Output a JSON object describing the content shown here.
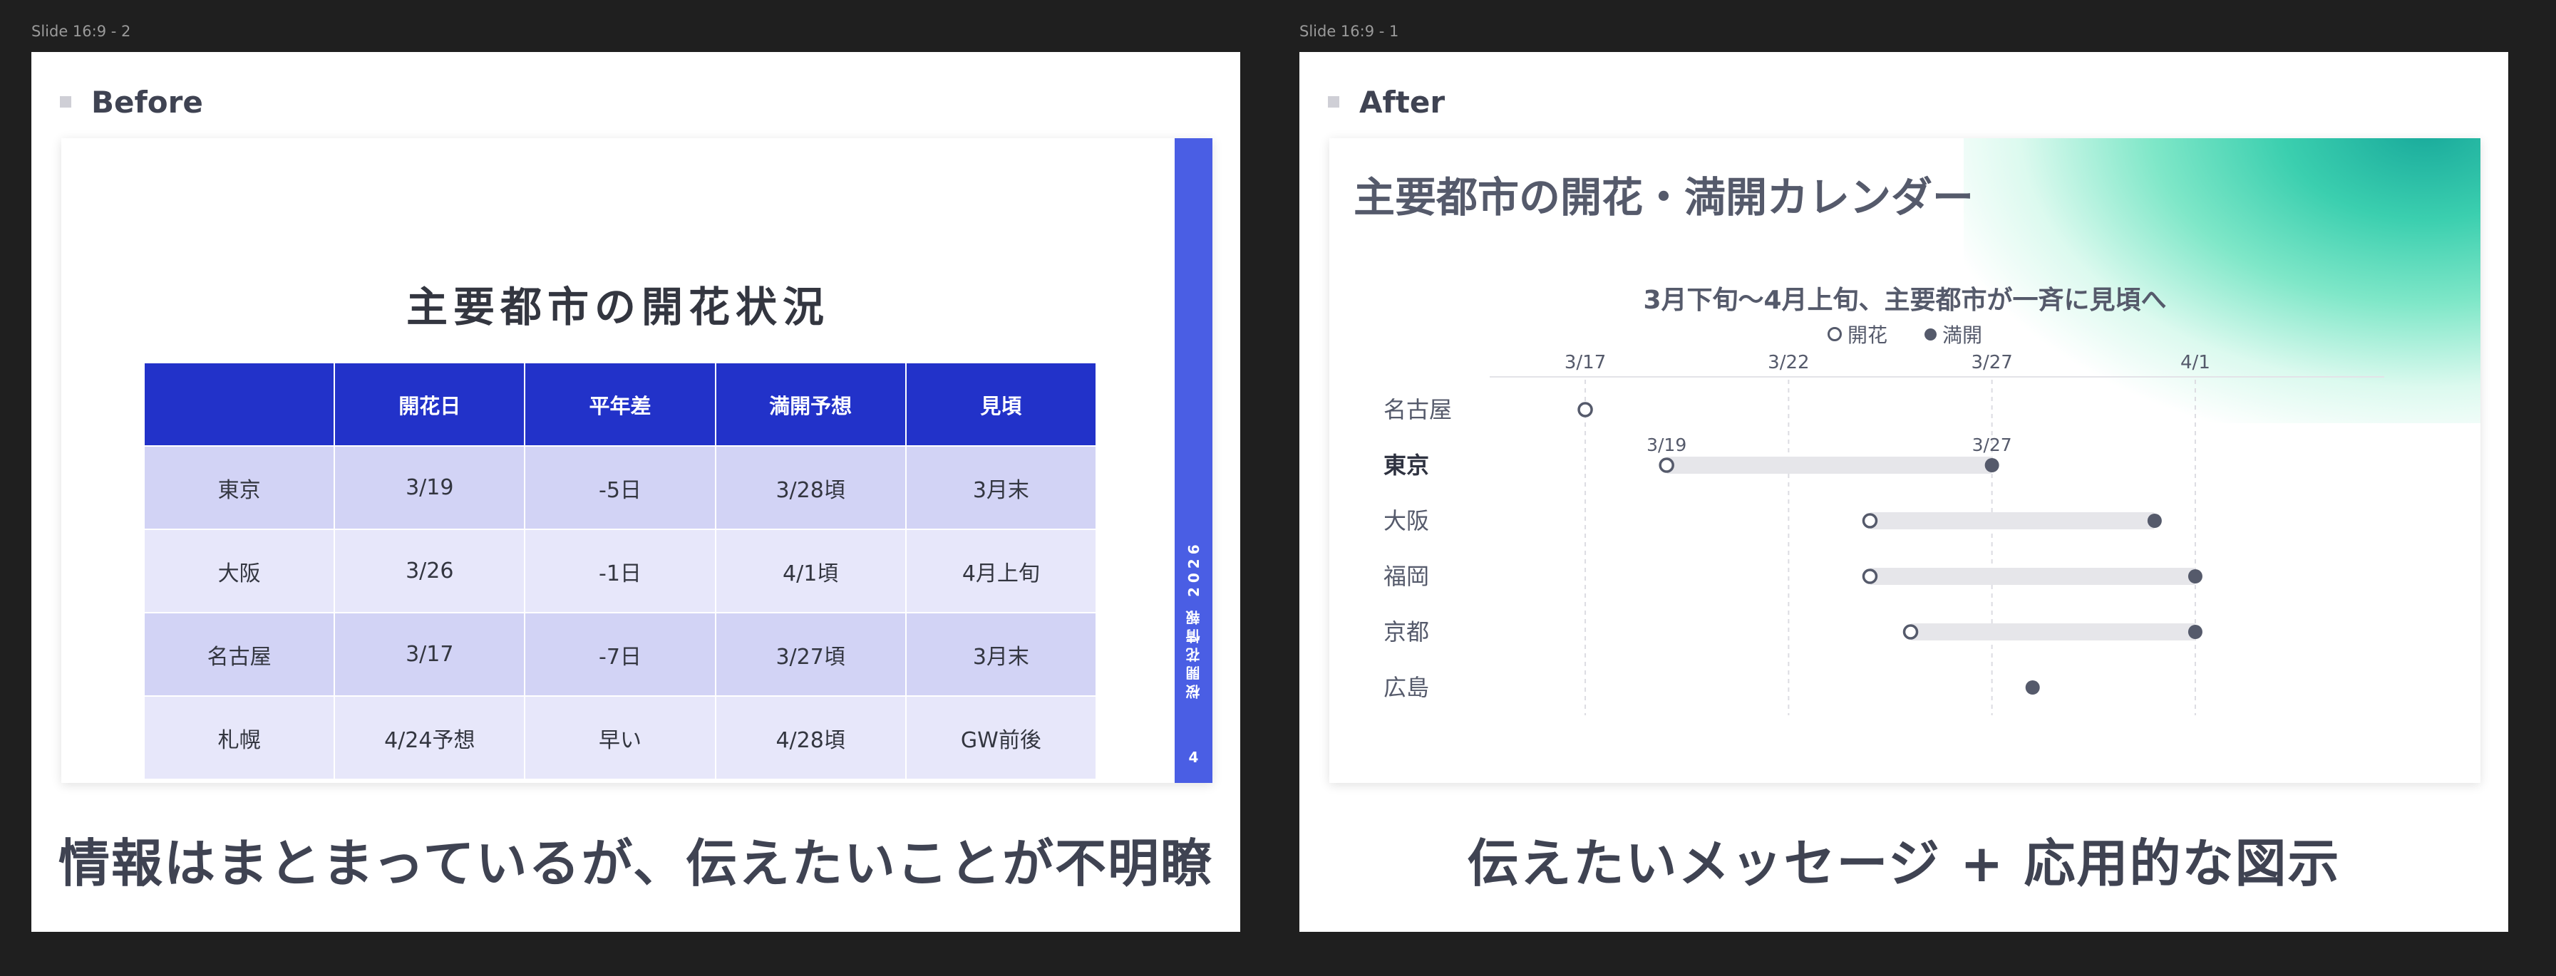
{
  "before": {
    "frame_label": "Slide 16:9 - 2",
    "section_title": "Before",
    "slide_title": "主要都市の開花状況",
    "table": {
      "headers": [
        "",
        "開花日",
        "平年差",
        "満開予想",
        "見頃"
      ],
      "rows": [
        [
          "東京",
          "3/19",
          "-5日",
          "3/28頃",
          "3月末"
        ],
        [
          "大阪",
          "3/26",
          "-1日",
          "4/1頃",
          "4月上旬"
        ],
        [
          "名古屋",
          "3/17",
          "-7日",
          "3/27頃",
          "3月末"
        ],
        [
          "札幌",
          "4/24予想",
          "早い",
          "4/28頃",
          "GW前後"
        ]
      ]
    },
    "side_band_text": "桜開花情報 2026",
    "page_number": "4",
    "caption": "情報はまとまっているが、伝えたいことが不明瞭"
  },
  "after": {
    "frame_label": "Slide 16:9 - 1",
    "section_title": "After",
    "slide_title": "主要都市の開花・満開カレンダー",
    "chart_data": {
      "type": "timeline",
      "title": "3月下旬〜4月上旬、主要都市が一斉に見頃へ",
      "legend": [
        {
          "name": "開花",
          "marker": "open-circle"
        },
        {
          "name": "満開",
          "marker": "filled-circle"
        }
      ],
      "x_axis": {
        "type": "date",
        "range": [
          "3/16",
          "4/2"
        ],
        "ticks": [
          "3/17",
          "3/22",
          "3/27",
          "4/1"
        ]
      },
      "rows": [
        {
          "city": "名古屋",
          "bloom": "3/17",
          "full": null,
          "bold": false
        },
        {
          "city": "東京",
          "bloom": "3/19",
          "full": "3/27",
          "bold": true,
          "bloom_label": "3/19",
          "full_label": "3/27"
        },
        {
          "city": "大阪",
          "bloom": "3/24",
          "full": "3/31",
          "bold": false
        },
        {
          "city": "福岡",
          "bloom": "3/24",
          "full": "4/1",
          "bold": false
        },
        {
          "city": "京都",
          "bloom": "3/25",
          "full": "4/1",
          "bold": false
        },
        {
          "city": "広島",
          "bloom": null,
          "full": "3/28",
          "bold": false
        }
      ]
    },
    "caption": "伝えたいメッセージ + 応用的な図示"
  },
  "colors": {
    "canvas": "#1f1f1f",
    "table_header": "#2232c9",
    "table_row_dark": "#d2d3f5",
    "table_row_light": "#e7e7fa",
    "side_band": "#4a5ee4",
    "chart_text": "#555a6b",
    "range_bar": "#e6e6ea",
    "accent_glow": "#3bcfaf"
  }
}
